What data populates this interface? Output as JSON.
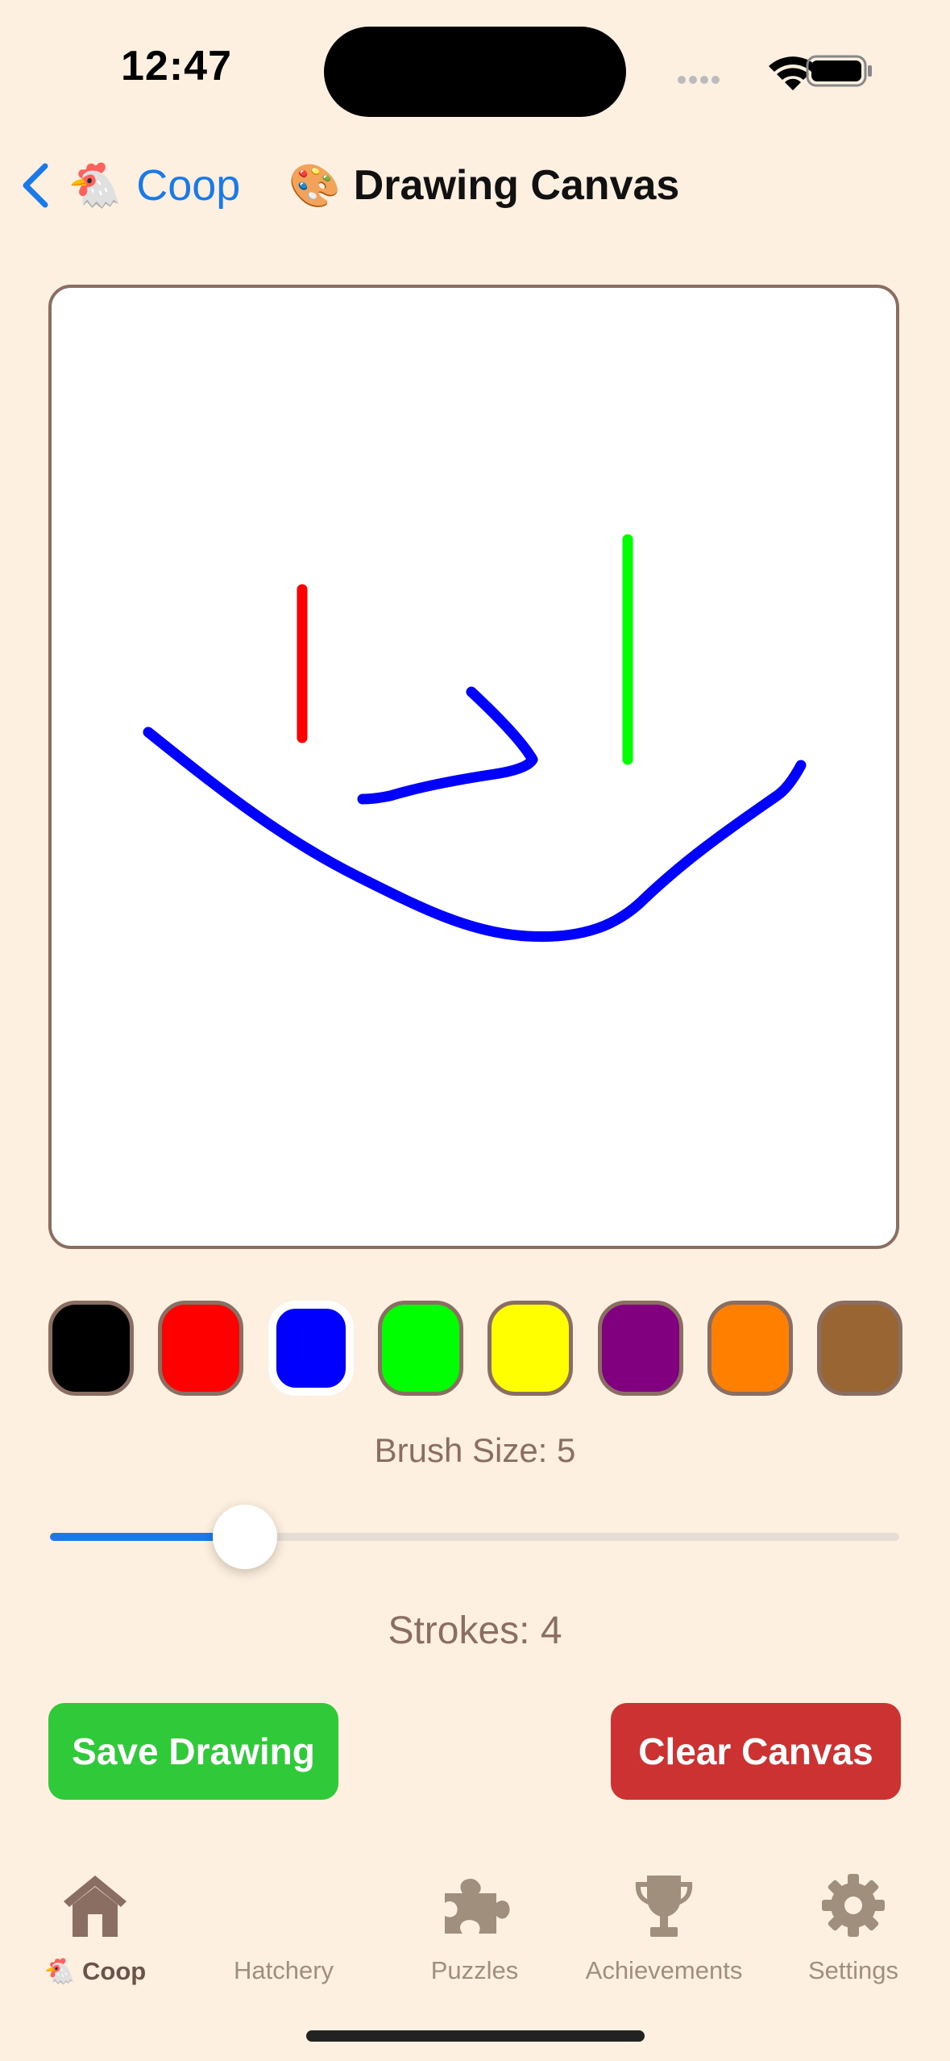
{
  "status_bar": {
    "time": "12:47"
  },
  "nav": {
    "back_icon": "chevron-left-icon",
    "back_emoji": "🐔",
    "back_label": "Coop",
    "title_emoji": "🎨",
    "title": "Drawing Canvas"
  },
  "palette": [
    {
      "name": "black",
      "color": "#000000",
      "selected": false
    },
    {
      "name": "red",
      "color": "#FF0000",
      "selected": false
    },
    {
      "name": "blue",
      "color": "#0000FF",
      "selected": true
    },
    {
      "name": "green",
      "color": "#00FF00",
      "selected": false
    },
    {
      "name": "yellow",
      "color": "#FFFF00",
      "selected": false
    },
    {
      "name": "purple",
      "color": "#800080",
      "selected": false
    },
    {
      "name": "orange",
      "color": "#FF8000",
      "selected": false
    },
    {
      "name": "brown",
      "color": "#996633",
      "selected": false
    }
  ],
  "brush": {
    "label": "Brush Size: 5",
    "value": 5,
    "fraction": 0.23
  },
  "strokes_label": "Strokes: 4",
  "buttons": {
    "save": "Save Drawing",
    "clear": "Clear Canvas"
  },
  "tabs": [
    {
      "label": "Coop",
      "emoji": "🐔",
      "icon": "house-icon",
      "active": true
    },
    {
      "label": "Hatchery",
      "icon": "",
      "active": false
    },
    {
      "label": "Puzzles",
      "icon": "puzzle-piece-icon",
      "active": false
    },
    {
      "label": "Achievements",
      "icon": "trophy-icon",
      "active": false
    },
    {
      "label": "Settings",
      "icon": "gear-icon",
      "active": false
    }
  ],
  "colors": {
    "background": "#FDF0E0",
    "accent": "#1A7BE8",
    "border": "#8B6E62",
    "save_button": "#2FC93A",
    "clear_button": "#CC3232"
  }
}
